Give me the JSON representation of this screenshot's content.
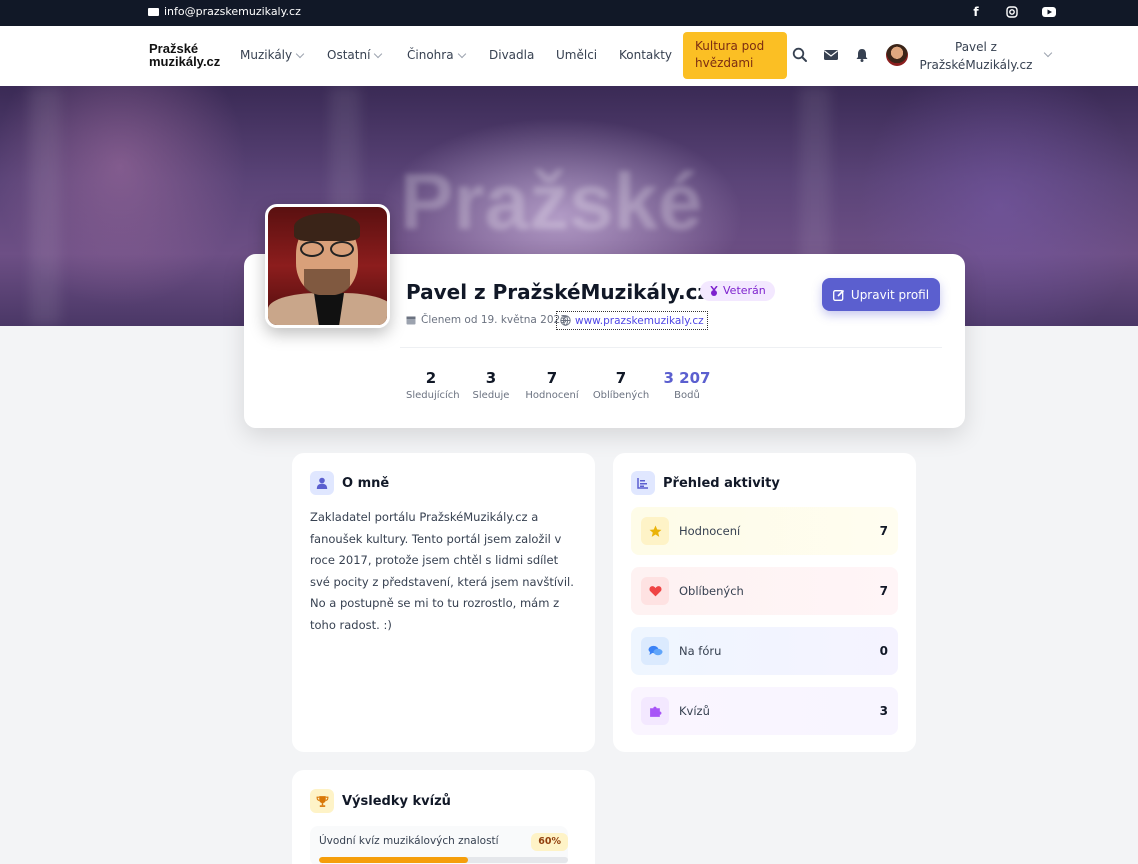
{
  "topbar": {
    "email": "info@prazskemuzikaly.cz",
    "social": [
      "facebook-icon",
      "instagram-icon",
      "youtube-icon"
    ]
  },
  "nav": {
    "logo_line1": "Pražské",
    "logo_line2": "muzikály.cz",
    "items": [
      {
        "label": "Muzikály",
        "dropdown": true
      },
      {
        "label": "Ostatní",
        "dropdown": true
      },
      {
        "label": "Činohra",
        "dropdown": true
      },
      {
        "label": "Divadla",
        "dropdown": false
      },
      {
        "label": "Umělci",
        "dropdown": false
      },
      {
        "label": "Kontakty",
        "dropdown": false
      }
    ],
    "cta": "Kultura pod hvězdami",
    "user_name": "Pavel z PražskéMuzikály.cz"
  },
  "hero": {
    "blurred_text": "Pražské"
  },
  "profile": {
    "name": "Pavel z PražskéMuzikály.cz",
    "badge": "Veterán",
    "member_since": "Členem od 19. května 2023",
    "website": "www.prazskemuzikaly.cz",
    "edit_label": "Upravit profil",
    "stats": [
      {
        "value": "2",
        "label": "Sledujících"
      },
      {
        "value": "3",
        "label": "Sleduje"
      },
      {
        "value": "7",
        "label": "Hodnocení"
      },
      {
        "value": "7",
        "label": "Oblíbených"
      },
      {
        "value": "3 207",
        "label": "Bodů"
      }
    ]
  },
  "about": {
    "title": "O mně",
    "text": "Zakladatel portálu PražskéMuzikály.cz a fanoušek kultury. Tento portál jsem založil v roce 2017, protože jsem chtěl s lidmi sdílet své pocity z představení, která jsem navštívil. No a postupně se mi to tu rozrostlo, mám z toho radost. :)"
  },
  "activity": {
    "title": "Přehled aktivity",
    "rows": [
      {
        "label": "Hodnocení",
        "value": "7",
        "icon": "star-icon",
        "color": "#eab308"
      },
      {
        "label": "Oblíbených",
        "value": "7",
        "icon": "heart-icon",
        "color": "#ef4444"
      },
      {
        "label": "Na fóru",
        "value": "0",
        "icon": "comments-icon",
        "color": "#3b82f6"
      },
      {
        "label": "Kvízů",
        "value": "3",
        "icon": "puzzle-icon",
        "color": "#a855f7"
      }
    ]
  },
  "quizzes": {
    "title": "Výsledky kvízů",
    "items": [
      {
        "name": "Úvodní kvíz muzikálových znalostí",
        "percent_label": "60%",
        "percent": 60
      }
    ]
  },
  "colors": {
    "accent": "#5b5fcf",
    "cta": "#fbbf24",
    "dark": "#111827"
  }
}
